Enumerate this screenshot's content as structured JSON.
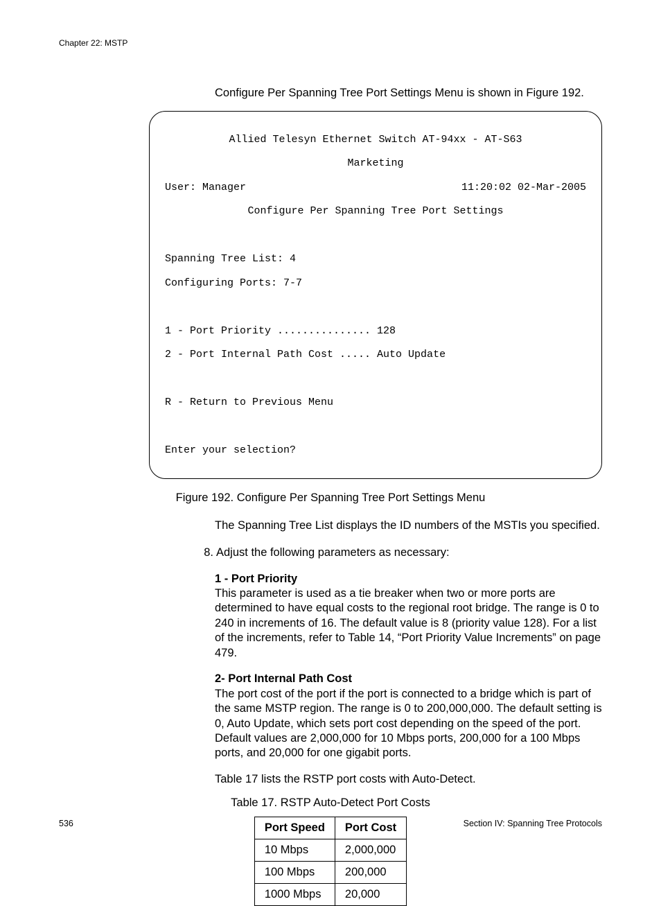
{
  "header": {
    "chapter": "Chapter 22: MSTP"
  },
  "intro": "Configure Per Spanning Tree Port Settings Menu is shown in Figure 192.",
  "terminal": {
    "title1": "Allied Telesyn Ethernet Switch AT-94xx - AT-S63",
    "title2": "Marketing",
    "user_label": "User: Manager",
    "timestamp": "11:20:02 02-Mar-2005",
    "menu_title": "Configure Per Spanning Tree Port Settings",
    "line_stl": "Spanning Tree List: 4",
    "line_cfg": "Configuring Ports: 7-7",
    "opt1": "1 - Port Priority ............... 128",
    "opt2": "2 - Port Internal Path Cost ..... Auto Update",
    "optR": "R - Return to Previous Menu",
    "prompt": "Enter your selection?"
  },
  "figure_caption": "Figure 192. Configure Per Spanning Tree Port Settings Menu",
  "para_after_fig": "The Spanning Tree List displays the ID numbers of the MSTIs you specified.",
  "step8": {
    "num": "8.",
    "text": "Adjust the following parameters as necessary:"
  },
  "param1": {
    "title": "1 - Port Priority",
    "body": "This parameter is used as a tie breaker when two or more ports are determined to have equal costs to the regional root bridge. The range is 0 to 240 in increments of 16. The default value is 8 (priority value 128). For a list of the increments, refer to Table 14, “Port Priority Value Increments” on page 479."
  },
  "param2": {
    "title": "2- Port Internal Path Cost",
    "body": "The port cost of the port if the port is connected to a bridge which is part of the same MSTP region. The range is 0 to 200,000,000. The default setting is 0, Auto Update, which sets port cost depending on the speed of the port. Default values are 2,000,000 for 10 Mbps ports, 200,000 for a 100 Mbps ports, and 20,000 for one gigabit ports."
  },
  "para_before_table": "Table 17 lists the RSTP port costs with Auto-Detect.",
  "table_caption": "Table 17. RSTP Auto-Detect Port Costs",
  "table": {
    "headers": [
      "Port Speed",
      "Port Cost"
    ],
    "rows": [
      [
        "10 Mbps",
        "2,000,000"
      ],
      [
        "100 Mbps",
        "200,000"
      ],
      [
        "1000 Mbps",
        "20,000"
      ]
    ]
  },
  "footer": {
    "pagenum": "536",
    "section": "Section IV: Spanning Tree Protocols"
  }
}
